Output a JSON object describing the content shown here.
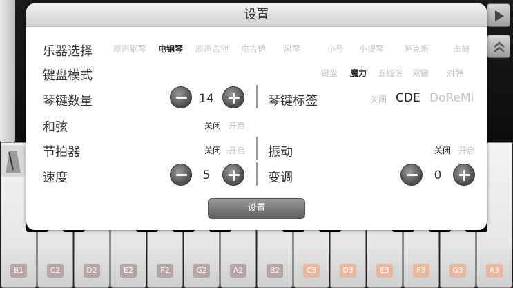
{
  "dialog": {
    "title": "设置",
    "instrument": {
      "label": "乐器选择",
      "options": [
        "原声钢琴",
        "电钢琴",
        "原声吉他",
        "电吉他",
        "风琴",
        "小号",
        "小提琴",
        "萨克斯",
        "击鼓"
      ],
      "selected": "电钢琴"
    },
    "keyboard_mode": {
      "label": "键盘模式",
      "options": [
        "键盘",
        "魔力",
        "五线谱",
        "双键",
        "对弹"
      ],
      "selected": "魔力"
    },
    "key_count": {
      "label": "琴键数量",
      "value": "14"
    },
    "key_labels": {
      "label": "琴键标签",
      "options": [
        "关闭",
        "CDE",
        "DoReMi"
      ],
      "selected": "CDE"
    },
    "chord": {
      "label": "和弦",
      "off": "关闭",
      "on": "开启",
      "selected": "off"
    },
    "metronome": {
      "label": "节拍器",
      "off": "关闭",
      "on": "开启",
      "selected": "off"
    },
    "vibration": {
      "label": "振动",
      "off": "关闭",
      "on": "开启",
      "selected": "off"
    },
    "speed": {
      "label": "速度",
      "value": "5"
    },
    "transpose": {
      "label": "变调",
      "value": "0"
    },
    "settings_button": "设置"
  },
  "keyboard": {
    "keys": [
      {
        "label": "B1",
        "tone": "gray"
      },
      {
        "label": "C2",
        "tone": "gray"
      },
      {
        "label": "D2",
        "tone": "gray"
      },
      {
        "label": "E2",
        "tone": "gray"
      },
      {
        "label": "F2",
        "tone": "gray"
      },
      {
        "label": "G2",
        "tone": "gray"
      },
      {
        "label": "A2",
        "tone": "gray"
      },
      {
        "label": "B2",
        "tone": "gray"
      },
      {
        "label": "C3",
        "tone": "orange"
      },
      {
        "label": "D3",
        "tone": "orange"
      },
      {
        "label": "E3",
        "tone": "orange"
      },
      {
        "label": "F3",
        "tone": "orange"
      },
      {
        "label": "G3",
        "tone": "orange"
      },
      {
        "label": "A3",
        "tone": "orange"
      }
    ]
  },
  "icons": {
    "play": "play-icon",
    "scroll_up": "double-chevron-up-icon",
    "metronome": "metronome-icon"
  }
}
